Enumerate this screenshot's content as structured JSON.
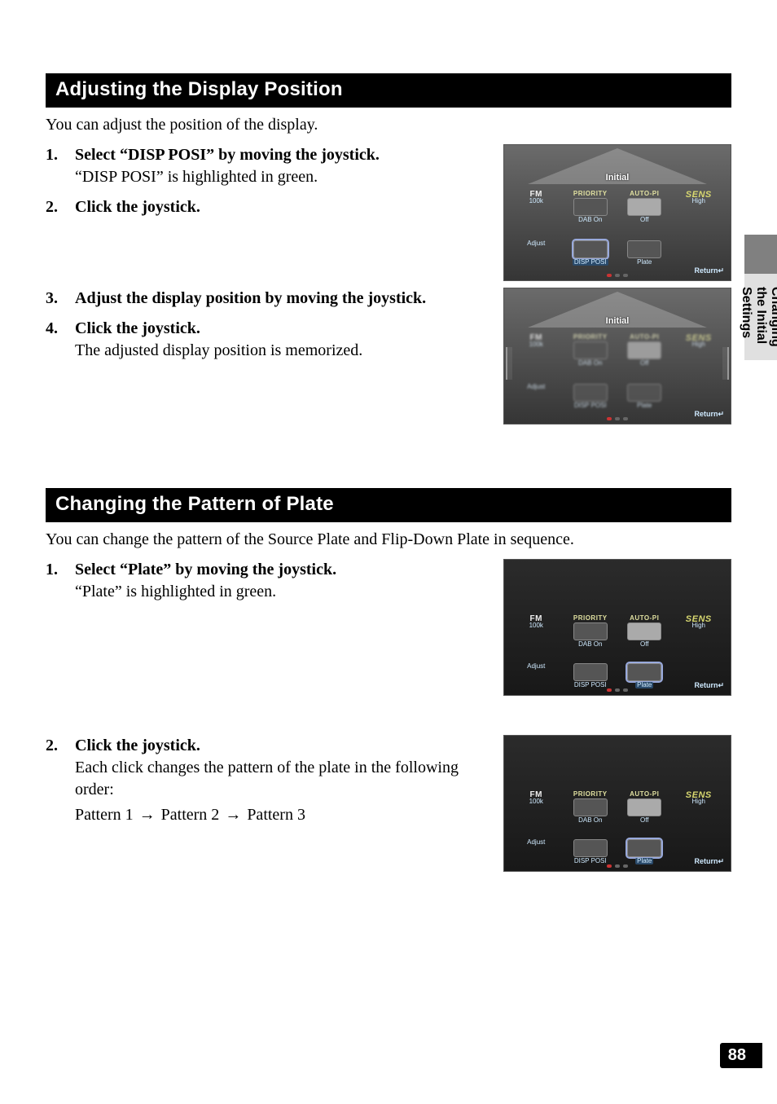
{
  "sideTab": {
    "label": "Changing the Initial Settings"
  },
  "pageNumber": "88",
  "section1": {
    "heading": "Adjusting the Display Position",
    "intro": "You can adjust the position of the display.",
    "steps": [
      {
        "num": "1.",
        "title": "Select “DISP POSI” by moving the joystick.",
        "note": "“DISP POSI” is highlighted in green."
      },
      {
        "num": "2.",
        "title": "Click the joystick.",
        "note": ""
      },
      {
        "num": "3.",
        "title": "Adjust the display position by moving the joystick.",
        "note": ""
      },
      {
        "num": "4.",
        "title": "Click the joystick.",
        "note": "The adjusted display position is memorized."
      }
    ]
  },
  "section2": {
    "heading": "Changing the Pattern of Plate",
    "intro": "You can change the pattern of the Source Plate and Flip-Down Plate in sequence.",
    "steps": [
      {
        "num": "1.",
        "title": "Select “Plate” by moving the joystick.",
        "note": "“Plate” is highlighted in green."
      },
      {
        "num": "2.",
        "title": "Click the joystick.",
        "note": "Each click changes the pattern of the plate in the following order:"
      }
    ],
    "sequence": [
      "Pattern 1",
      "Pattern 2",
      "Pattern 3"
    ]
  },
  "thumbCommon": {
    "initial": "Initial",
    "return": "Return↵",
    "cells": {
      "fm": {
        "top": "FM",
        "bottom": "100k"
      },
      "priority": {
        "top": "PRIORITY",
        "bottom": "DAB On"
      },
      "autopi": {
        "top": "AUTO-PI",
        "bottom": "Off"
      },
      "sens": {
        "top": "SENS",
        "bottom": "High"
      },
      "adjust": {
        "top": "",
        "bottom": "Adjust"
      },
      "disp": {
        "top": "",
        "bottom": "DISP POSI"
      },
      "plate": {
        "top": "",
        "bottom": "Plate"
      }
    }
  }
}
